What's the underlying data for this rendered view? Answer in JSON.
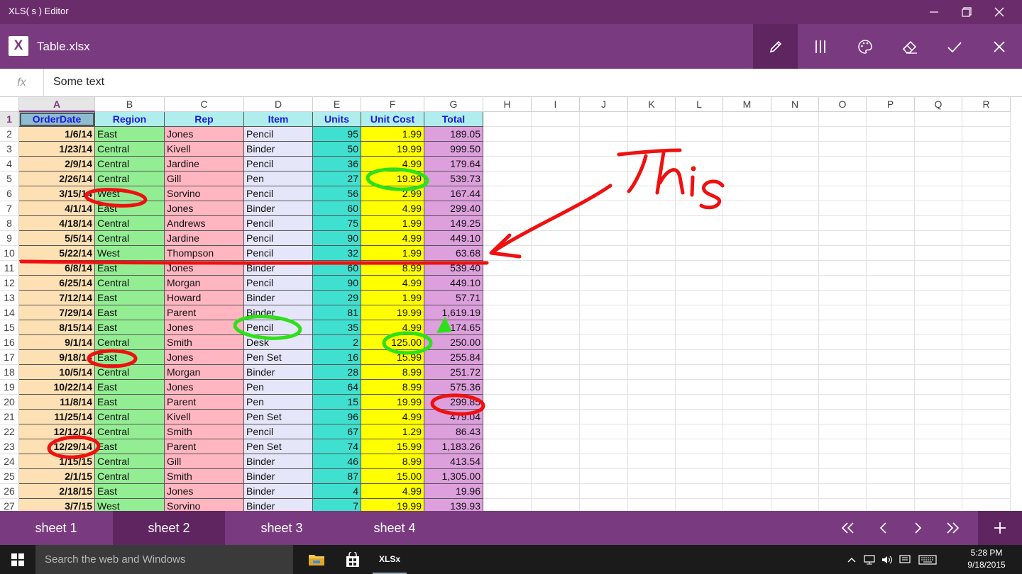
{
  "window": {
    "title": "XLS( s ) Editor"
  },
  "app": {
    "logo_letter": "X",
    "file_name": "Table.xlsx",
    "accent": "#7a3a80"
  },
  "toolbar": {
    "buttons": [
      {
        "name": "pen-icon",
        "active": true
      },
      {
        "name": "columns-icon"
      },
      {
        "name": "palette-icon"
      },
      {
        "name": "eraser-icon"
      },
      {
        "name": "check-icon"
      },
      {
        "name": "close-icon"
      }
    ]
  },
  "formula": {
    "label": "fx",
    "value": "Some text"
  },
  "grid": {
    "col_headers": [
      "A",
      "B",
      "C",
      "D",
      "E",
      "F",
      "G",
      "H",
      "I",
      "J",
      "K",
      "L",
      "M",
      "N",
      "O",
      "P",
      "Q",
      "R"
    ],
    "selected_col": "A",
    "header_row": [
      "OrderDate",
      "Region",
      "Rep",
      "Item",
      "Units",
      "Unit Cost",
      "Total"
    ],
    "rows": [
      [
        "1/6/14",
        "East",
        "Jones",
        "Pencil",
        "95",
        "1.99",
        "189.05"
      ],
      [
        "1/23/14",
        "Central",
        "Kivell",
        "Binder",
        "50",
        "19.99",
        "999.50"
      ],
      [
        "2/9/14",
        "Central",
        "Jardine",
        "Pencil",
        "36",
        "4.99",
        "179.64"
      ],
      [
        "2/26/14",
        "Central",
        "Gill",
        "Pen",
        "27",
        "19.99",
        "539.73"
      ],
      [
        "3/15/14",
        "West",
        "Sorvino",
        "Pencil",
        "56",
        "2.99",
        "167.44"
      ],
      [
        "4/1/14",
        "East",
        "Jones",
        "Binder",
        "60",
        "4.99",
        "299.40"
      ],
      [
        "4/18/14",
        "Central",
        "Andrews",
        "Pencil",
        "75",
        "1.99",
        "149.25"
      ],
      [
        "5/5/14",
        "Central",
        "Jardine",
        "Pencil",
        "90",
        "4.99",
        "449.10"
      ],
      [
        "5/22/14",
        "West",
        "Thompson",
        "Pencil",
        "32",
        "1.99",
        "63.68"
      ],
      [
        "6/8/14",
        "East",
        "Jones",
        "Binder",
        "60",
        "8.99",
        "539.40"
      ],
      [
        "6/25/14",
        "Central",
        "Morgan",
        "Pencil",
        "90",
        "4.99",
        "449.10"
      ],
      [
        "7/12/14",
        "East",
        "Howard",
        "Binder",
        "29",
        "1.99",
        "57.71"
      ],
      [
        "7/29/14",
        "East",
        "Parent",
        "Binder",
        "81",
        "19.99",
        "1,619.19"
      ],
      [
        "8/15/14",
        "East",
        "Jones",
        "Pencil",
        "35",
        "4.99",
        "174.65"
      ],
      [
        "9/1/14",
        "Central",
        "Smith",
        "Desk",
        "2",
        "125.00",
        "250.00"
      ],
      [
        "9/18/14",
        "East",
        "Jones",
        "Pen Set",
        "16",
        "15.99",
        "255.84"
      ],
      [
        "10/5/14",
        "Central",
        "Morgan",
        "Binder",
        "28",
        "8.99",
        "251.72"
      ],
      [
        "10/22/14",
        "East",
        "Jones",
        "Pen",
        "64",
        "8.99",
        "575.36"
      ],
      [
        "11/8/14",
        "East",
        "Parent",
        "Pen",
        "15",
        "19.99",
        "299.85"
      ],
      [
        "11/25/14",
        "Central",
        "Kivell",
        "Pen Set",
        "96",
        "4.99",
        "479.04"
      ],
      [
        "12/12/14",
        "Central",
        "Smith",
        "Pencil",
        "67",
        "1.29",
        "86.43"
      ],
      [
        "12/29/14",
        "East",
        "Parent",
        "Pen Set",
        "74",
        "15.99",
        "1,183.26"
      ],
      [
        "1/15/15",
        "Central",
        "Gill",
        "Binder",
        "46",
        "8.99",
        "413.54"
      ],
      [
        "2/1/15",
        "Central",
        "Smith",
        "Binder",
        "87",
        "15.00",
        "1,305.00"
      ],
      [
        "2/18/15",
        "East",
        "Jones",
        "Binder",
        "4",
        "4.99",
        "19.96"
      ],
      [
        "3/7/15",
        "West",
        "Sorvino",
        "Binder",
        "7",
        "19.99",
        "139.93"
      ]
    ],
    "col_colors": [
      "#fde0b4",
      "#93ee93",
      "#ffb6c1",
      "#e6e6fa",
      "#40e0d0",
      "#ffff00",
      "#dda0dd"
    ],
    "header_bg": "#b0eeee",
    "header_text_color": "#1a1ad8"
  },
  "annotations": {
    "text": "This"
  },
  "sheets": {
    "tabs": [
      "sheet 1",
      "sheet 2",
      "sheet 3",
      "sheet 4"
    ],
    "active_index": 1
  },
  "taskbar": {
    "search_placeholder": "Search the web and Windows",
    "time": "5:28 PM",
    "date": "9/18/2015",
    "app_label": "XLSx"
  }
}
